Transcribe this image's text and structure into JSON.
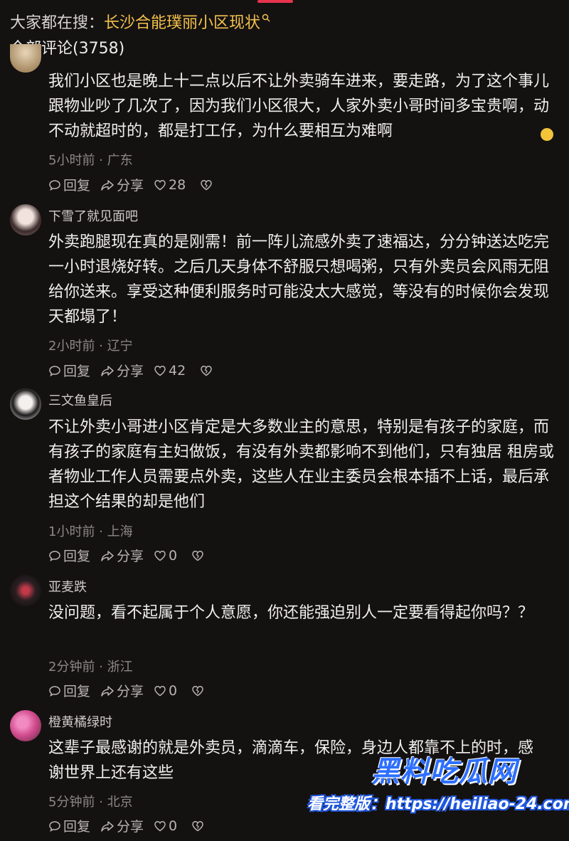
{
  "header": {
    "search_prefix": "大家都在搜：",
    "search_keyword": "长沙合能璞丽小区现状",
    "all_comments": "全部评论(3758)"
  },
  "actions": {
    "reply": "回复",
    "share": "分享"
  },
  "comments": [
    {
      "username": "",
      "text": "我们小区也是晚上十二点以后不让外卖骑车进来，要走路，为了这个事儿跟物业吵了几次了，因为我们小区很大，人家外卖小哥时间多宝贵啊，动不动就超时的，都是打工仔，为什么要相互为难啊",
      "meta": "5小时前 · 广东",
      "likes": "28"
    },
    {
      "username": "下雪了就见面吧",
      "text": "外卖跑腿现在真的是刚需！前一阵儿流感外卖了速福达，分分钟送达吃完一小时退烧好转。之后几天身体不舒服只想喝粥，只有外卖员会风雨无阻给你送来。享受这种便利服务时可能没太大感觉，等没有的时候你会发现天都塌了！",
      "meta": "2小时前 · 辽宁",
      "likes": "42"
    },
    {
      "username": "三文鱼皇后",
      "text": "不让外卖小哥进小区肯定是大多数业主的意思，特别是有孩子的家庭，而有孩子的家庭有主妇做饭，有没有外卖都影响不到他们，只有独居 租房或者物业工作人员需要点外卖，这些人在业主委员会根本插不上话，最后承担这个结果的却是他们",
      "meta": "1小时前 · 上海",
      "likes": "0"
    },
    {
      "username": "亚麦跌",
      "text": "没问题，看不起属于个人意愿，你还能强迫别人一定要看得起你吗？？",
      "meta": "2分钟前 · 浙江",
      "likes": "0"
    },
    {
      "username": "橙黄橘绿时",
      "text": "这辈子最感谢的就是外卖员，滴滴车，保险，身边人都靠不上的时，感谢世界上还有这些",
      "meta": "5分钟前 · 北京",
      "likes": "0"
    }
  ],
  "watermark": {
    "brand": "黑料吃瓜网",
    "url_line": "看完整版：https://heiliao-24.com"
  }
}
